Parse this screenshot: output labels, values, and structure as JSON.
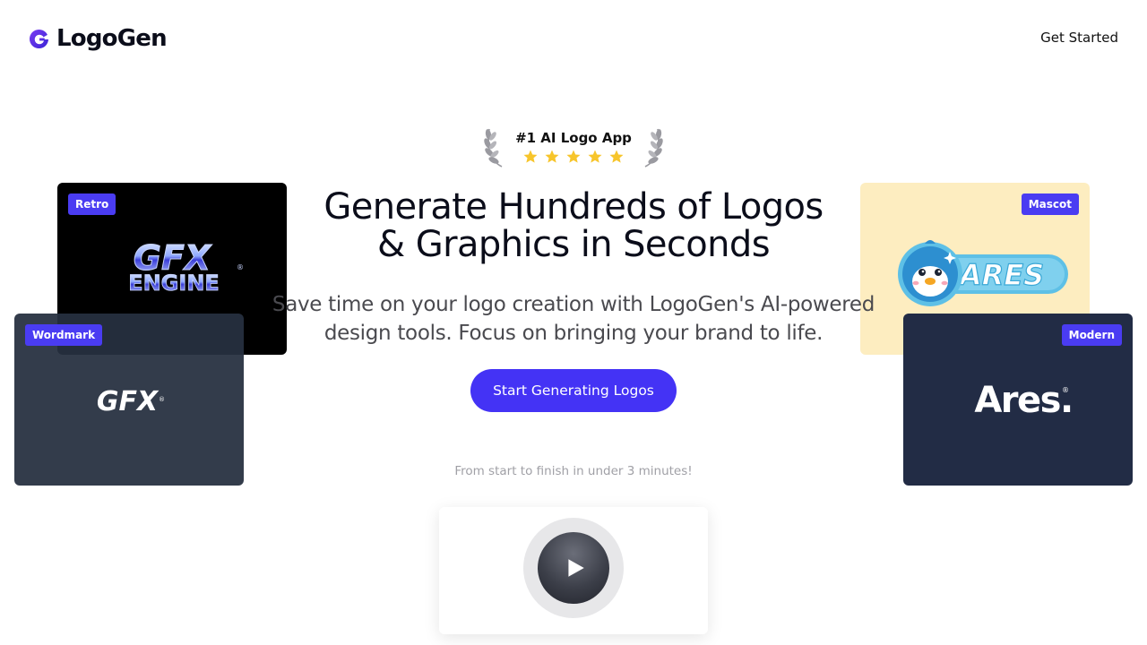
{
  "header": {
    "brand_name": "LogoGen",
    "brand_icon": "logogen-g-mark-icon",
    "cta_label": "Get Started"
  },
  "award": {
    "title": "#1 AI Logo App",
    "rating": 5,
    "max_rating": 5,
    "laurel_icon": "laurel-wreath-icon",
    "star_color": "#f7c52b"
  },
  "hero": {
    "title_line1": "Generate Hundreds of Logos",
    "title_line2": "& Graphics in Seconds",
    "subtitle_line1": "Save time on your logo creation with LogoGen's AI-powered",
    "subtitle_line2": "design tools. Focus on bringing your brand to life.",
    "button_label": "Start Generating Logos",
    "note": "From start to finish in under 3 minutes!"
  },
  "video": {
    "play_icon": "play-icon"
  },
  "cards": {
    "retro": {
      "badge": "Retro",
      "logo_line1": "GFX",
      "logo_line2": "ENGINE",
      "mark": "®"
    },
    "wordmark": {
      "badge": "Wordmark",
      "logo_text": "GFX",
      "mark": "®"
    },
    "mascot": {
      "badge": "Mascot",
      "logo_text": "ARES",
      "mascot_icon": "penguin-mascot-icon"
    },
    "modern": {
      "badge": "Modern",
      "logo_text": "Ares.",
      "mark": "®"
    }
  },
  "colors": {
    "accent": "#4433f5",
    "badge": "#4a3cf2",
    "mascot_bg": "#fdedc0",
    "modern_bg": "#222c45",
    "wordmark_bg": "#263040"
  }
}
